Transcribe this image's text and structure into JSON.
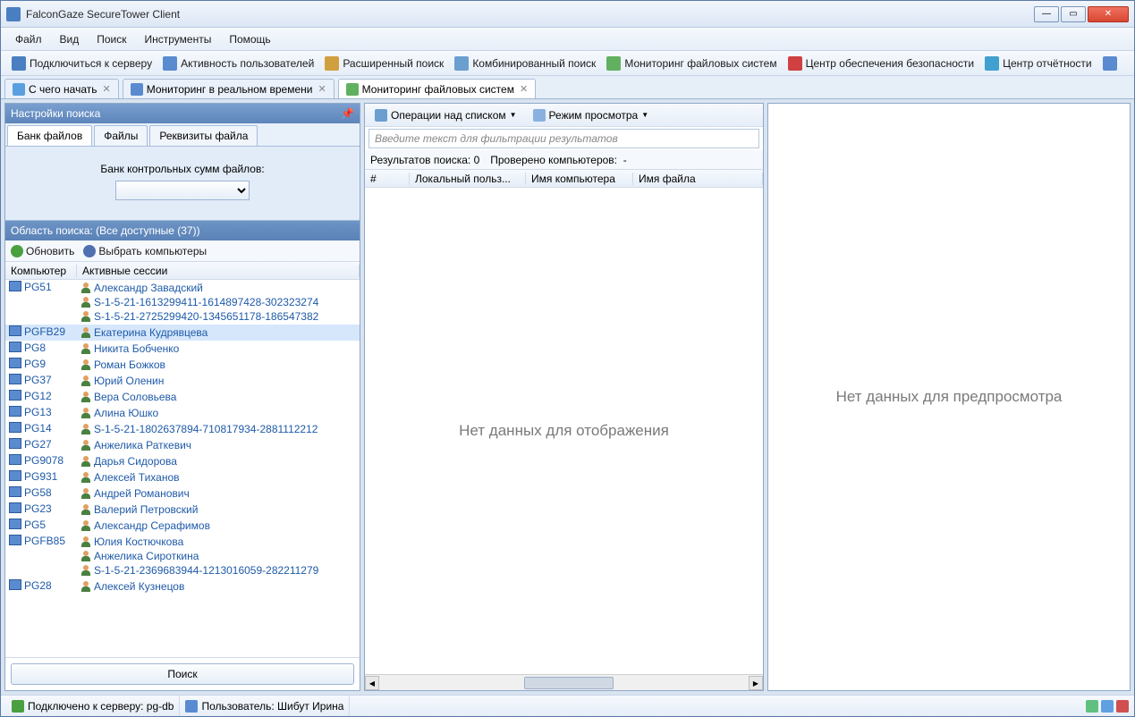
{
  "window": {
    "title": "FalconGaze SecureTower Client"
  },
  "menu": {
    "file": "Файл",
    "view": "Вид",
    "search": "Поиск",
    "tools": "Инструменты",
    "help": "Помощь"
  },
  "toolbar": [
    {
      "label": "Подключиться к серверу",
      "icon": "#4a7fc1"
    },
    {
      "label": "Активность пользователей",
      "icon": "#5a8bd0"
    },
    {
      "label": "Расширенный поиск",
      "icon": "#d0a040"
    },
    {
      "label": "Комбинированный поиск",
      "icon": "#6a9fd0"
    },
    {
      "label": "Мониторинг файловых систем",
      "icon": "#60b060"
    },
    {
      "label": "Центр обеспечения безопасности",
      "icon": "#d04040"
    },
    {
      "label": "Центр отчётности",
      "icon": "#40a0d0"
    }
  ],
  "tabs": [
    {
      "label": "С чего начать",
      "icon": "#5aa0e0"
    },
    {
      "label": "Мониторинг в реальном времени",
      "icon": "#5a8bd0"
    },
    {
      "label": "Мониторинг файловых систем",
      "icon": "#60b060",
      "active": true
    }
  ],
  "left": {
    "header": "Настройки поиска",
    "innerTabs": {
      "bank": "Банк файлов",
      "files": "Файлы",
      "props": "Реквизиты файла"
    },
    "bankLabel": "Банк контрольных сумм файлов:",
    "subHeader": "Область поиска: (Все доступные (37))",
    "refresh": "Обновить",
    "select": "Выбрать компьютеры",
    "colComputer": "Компьютер",
    "colSessions": "Активные сессии",
    "searchBtn": "Поиск",
    "rows": [
      {
        "pc": "PG51",
        "sessions": [
          "Александр Завадский",
          "S-1-5-21-1613299411-1614897428-302323274",
          "S-1-5-21-2725299420-1345651178-186547382"
        ]
      },
      {
        "pc": "PGFB29",
        "sessions": [
          "Екатерина Кудрявцева"
        ],
        "sel": true
      },
      {
        "pc": "PG8",
        "sessions": [
          "Никита Бобченко"
        ]
      },
      {
        "pc": "PG9",
        "sessions": [
          "Роман Божков"
        ]
      },
      {
        "pc": "PG37",
        "sessions": [
          "Юрий Оленин"
        ]
      },
      {
        "pc": "PG12",
        "sessions": [
          "Вера Соловьева"
        ]
      },
      {
        "pc": "PG13",
        "sessions": [
          "Алина Юшко"
        ]
      },
      {
        "pc": "PG14",
        "sessions": [
          "S-1-5-21-1802637894-710817934-2881112212"
        ]
      },
      {
        "pc": "PG27",
        "sessions": [
          "Анжелика Раткевич"
        ]
      },
      {
        "pc": "PG9078",
        "sessions": [
          "Дарья Сидорова"
        ]
      },
      {
        "pc": "PG931",
        "sessions": [
          "Алексей Тиханов"
        ]
      },
      {
        "pc": "PG58",
        "sessions": [
          "Андрей Романович"
        ]
      },
      {
        "pc": "PG23",
        "sessions": [
          "Валерий Петровский"
        ]
      },
      {
        "pc": "PG5",
        "sessions": [
          "Александр Серафимов"
        ]
      },
      {
        "pc": "PGFB85",
        "sessions": [
          "Юлия Костючкова",
          "Анжелика Сироткина",
          "S-1-5-21-2369683944-1213016059-282211279"
        ]
      },
      {
        "pc": "PG28",
        "sessions": [
          "Алексей Кузнецов"
        ]
      }
    ]
  },
  "mid": {
    "opList": "Операции над списком",
    "viewMode": "Режим просмотра",
    "filterPlaceholder": "Введите текст для фильтрации результатов",
    "resultsLabel": "Результатов поиска:",
    "resultsCount": "0",
    "checkedLabel": "Проверено компьютеров:",
    "checkedCount": "-",
    "colNum": "#",
    "colUser": "Локальный польз...",
    "colHost": "Имя компьютера",
    "colFile": "Имя файла",
    "empty": "Нет данных для отображения"
  },
  "right": {
    "empty": "Нет данных для предпросмотра"
  },
  "status": {
    "connected": "Подключено к серверу: pg-db",
    "user": "Пользователь: Шибут Ирина"
  }
}
